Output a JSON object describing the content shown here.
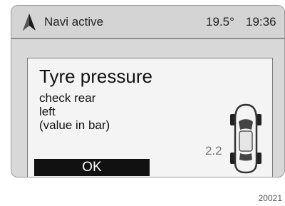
{
  "status_bar": {
    "navi_label": "Navi active",
    "temperature": "19.5°",
    "time": "19:36"
  },
  "dialog": {
    "title": "Tyre pressure",
    "lines": [
      "check rear",
      "left",
      "(value in bar)"
    ],
    "ok_label": "OK",
    "pressure_value": "2.2"
  },
  "figure_number": "20021",
  "icons": {
    "navigation": "navigation-arrow-icon",
    "vehicle": "car-top-view-icon"
  },
  "colors": {
    "screen_background": "#d8d8d8",
    "dialog_background": "#f4f4f4",
    "ok_button": "#111111"
  }
}
